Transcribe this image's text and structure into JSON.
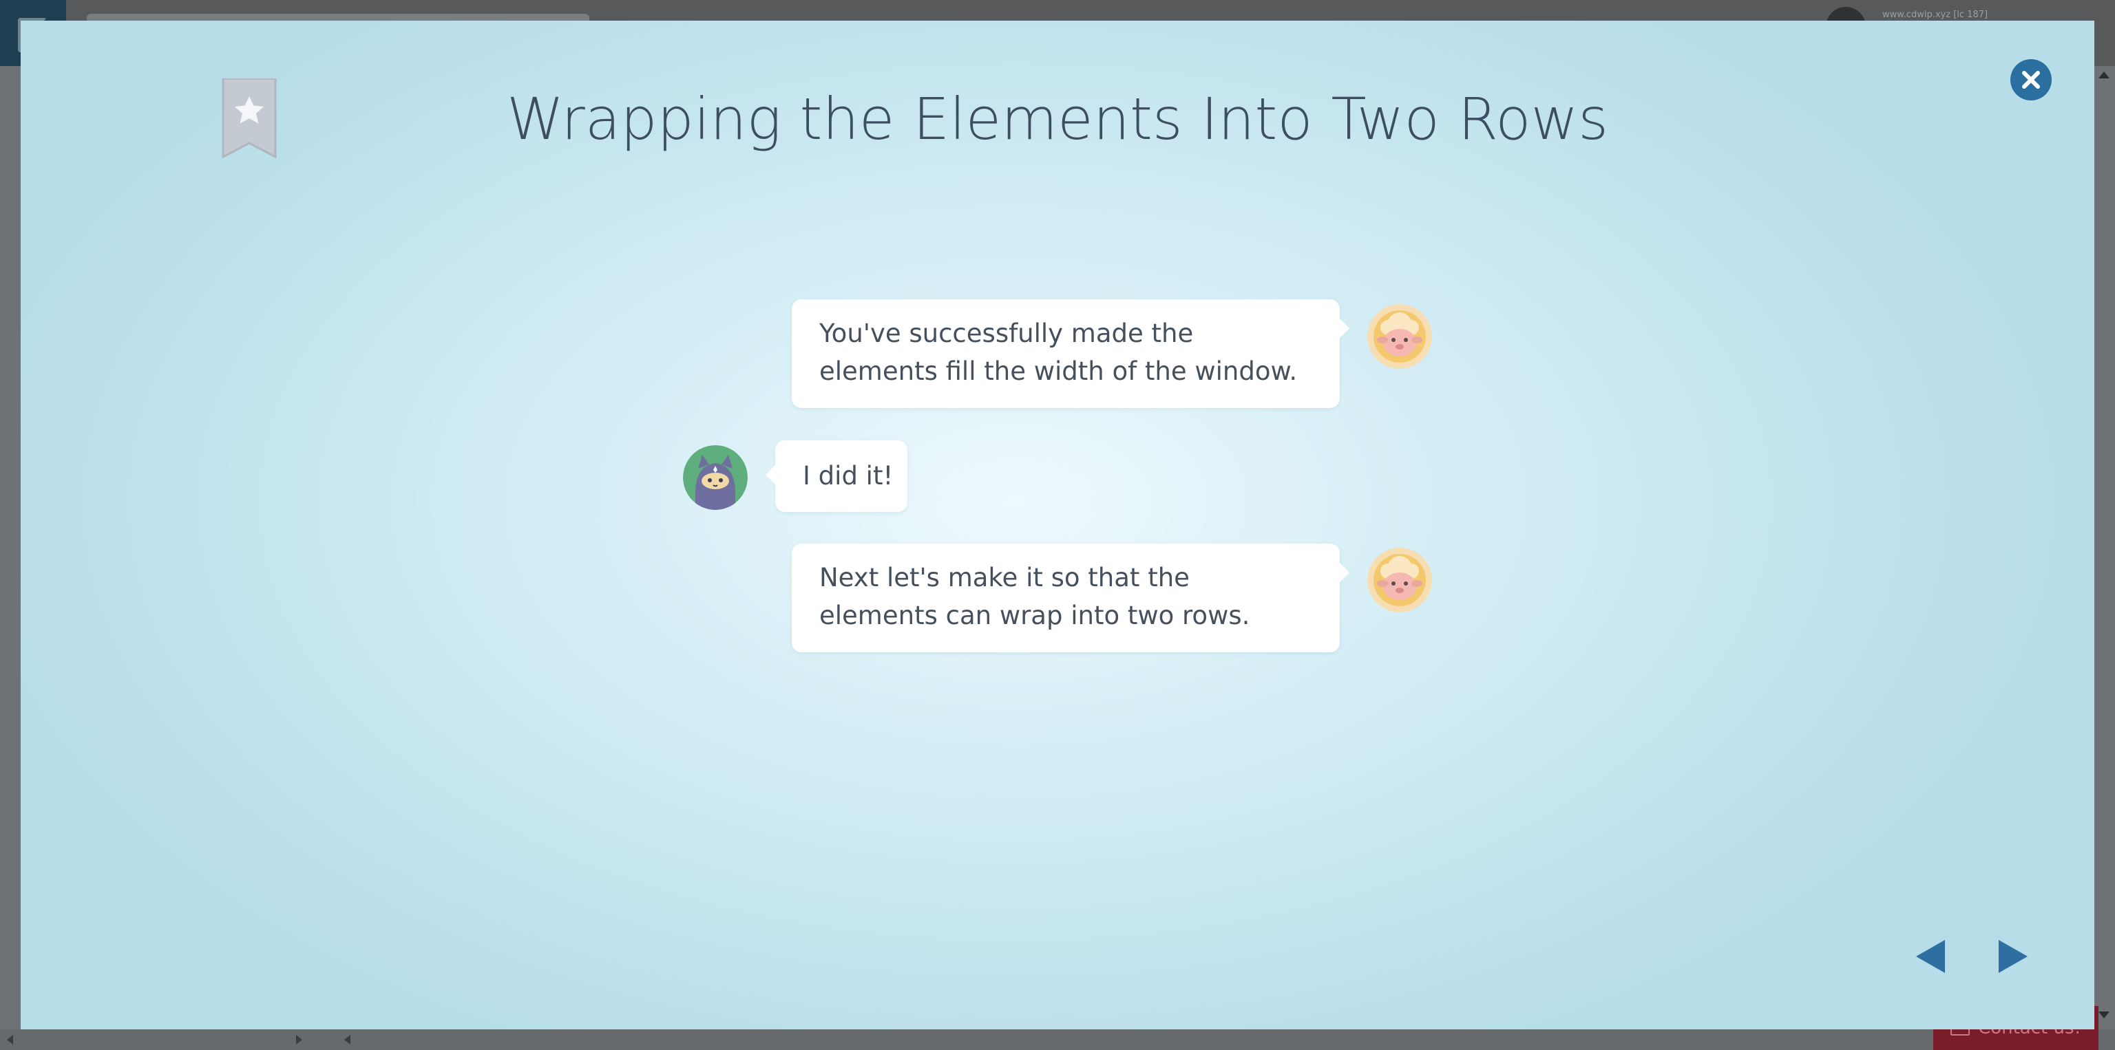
{
  "background": {
    "url_text": "www.cdwlp.xyz [lc 187]",
    "contact_label": "Contact us!"
  },
  "modal": {
    "title": "Wrapping the Elements Into Two Rows",
    "bookmark_icon": "bookmark-star-icon",
    "close_icon": "close-x-icon",
    "colors": {
      "title": "#3c4e60",
      "accent": "#2b6fa0",
      "bubble": "#ffffff",
      "text": "#45505c"
    }
  },
  "chat": {
    "messages": [
      {
        "speaker": "sheep",
        "side": "right",
        "text": "You've successfully made the elements fill the width of the window."
      },
      {
        "speaker": "ninja",
        "side": "left",
        "text": "I did it!"
      },
      {
        "speaker": "sheep",
        "side": "right",
        "text": "Next let's make it so that the elements can wrap into two rows."
      }
    ]
  },
  "nav": {
    "prev_icon": "triangle-left-icon",
    "next_icon": "triangle-right-icon"
  }
}
